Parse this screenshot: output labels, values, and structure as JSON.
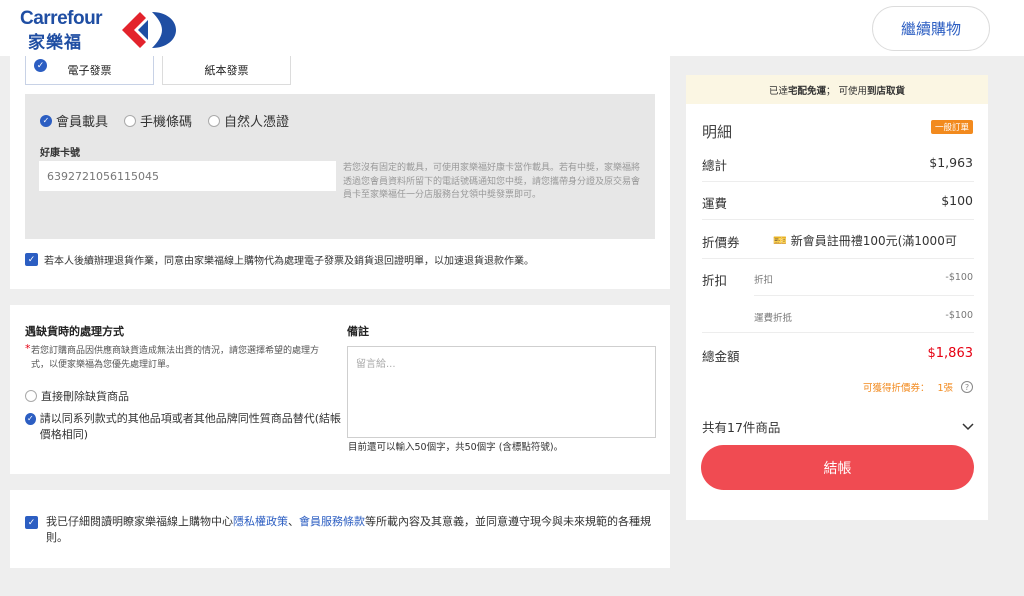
{
  "header": {
    "logo_en": "Carrefour",
    "logo_zh": "家樂福",
    "continue_label": "繼續購物"
  },
  "invoice": {
    "tabs": [
      {
        "label": "電子發票",
        "active": true
      },
      {
        "label": "紙本發票",
        "active": false
      }
    ],
    "carriers": [
      {
        "label": "會員載具",
        "selected": true
      },
      {
        "label": "手機條碼",
        "selected": false
      },
      {
        "label": "自然人憑證",
        "selected": false
      }
    ],
    "card_label": "好康卡號",
    "card_value": "6392721056115045",
    "help_text": "若您沒有固定的載具，可使用家樂福好康卡當作載具。若有中獎，家樂福將透過您會員資料所留下的電話號碼通知您中獎，請您攜帶身分證及原交易會員卡至家樂福任一分店服務台兌領中獎發票即可。",
    "consent_text": "若本人後續辦理退貨作業，同意由家樂福線上購物代為處理電子發票及銷貨退回證明單，以加速退貨退款作業。"
  },
  "out_of_stock": {
    "title": "遇缺貨時的處理方式",
    "desc": "若您訂購商品因供應商缺貨造成無法出貨的情況，請您選擇希望的處理方式，以便家樂福為您優先處理訂單。",
    "options": [
      {
        "label": "直接刪除缺貨商品",
        "selected": false
      },
      {
        "label": "請以同系列款式的其他品項或者其他品牌同性質商品替代(結帳價格相同)",
        "selected": true
      }
    ]
  },
  "notes": {
    "title": "備註",
    "placeholder": "留言給...",
    "hint": "目前還可以輸入50個字，共50個字 (含標點符號)。"
  },
  "agreement": {
    "prefix": "我已仔細閱讀明瞭家樂福線上購物中心",
    "privacy_link": "隱私權政策",
    "sep": "、",
    "terms_link": "會員服務條款",
    "suffix": "等所載內容及其意義，並同意遵守現今與未來規範的各種規則。"
  },
  "summary": {
    "notice_prefix": "已達",
    "notice_bold1": "宅配免運",
    "notice_mid": "； 可使用 ",
    "notice_bold2": "到店取貨",
    "title": "明細",
    "badge": "一般訂單",
    "subtotal_label": "總計",
    "subtotal_value": "$1,963",
    "shipping_label": "運費",
    "shipping_value": "$100",
    "coupon_label": "折價券",
    "coupon_text": "新會員註冊禮100元(滿1000可",
    "discount_label": "折扣",
    "discount_rows": [
      {
        "label": "折扣",
        "value": "-$100"
      },
      {
        "label": "運費折抵",
        "value": "-$100"
      }
    ],
    "total_label": "總金額",
    "total_value": "$1,863",
    "obtain_label": "可獲得折價券：",
    "obtain_count": "1張",
    "items_label": "共有17件商品",
    "checkout_label": "結帳"
  },
  "colors": {
    "brand_blue": "#2c5ec2",
    "checkout_red": "#f04b52",
    "badge_orange": "#f28a1e",
    "total_red": "#e60012"
  }
}
